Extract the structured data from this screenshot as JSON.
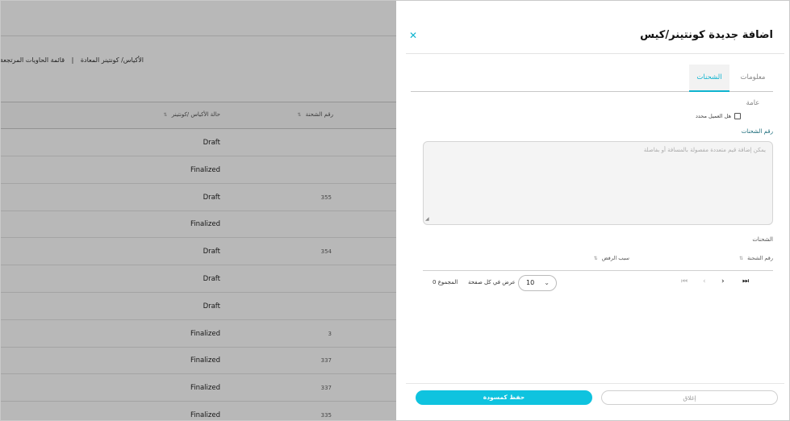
{
  "background": {
    "breadcrumb": {
      "item1": "الأكياس/ كونتينر المعادة",
      "separator": "|",
      "item2": "قائمة الحاويات المرتجعة"
    },
    "columns": {
      "status": "حالة الأكياس /كونتينر",
      "shipment_no": "رقم الشحنة"
    },
    "rows": [
      {
        "status": "Draft",
        "num": ""
      },
      {
        "status": "Finalized",
        "num": ""
      },
      {
        "status": "Draft",
        "num": "355"
      },
      {
        "status": "Finalized",
        "num": ""
      },
      {
        "status": "Draft",
        "num": "354"
      },
      {
        "status": "Draft",
        "num": ""
      },
      {
        "status": "Draft",
        "num": ""
      },
      {
        "status": "Finalized",
        "num": "3"
      },
      {
        "status": "Finalized",
        "num": "337"
      },
      {
        "status": "Finalized",
        "num": "337"
      },
      {
        "status": "Finalized",
        "num": "335"
      }
    ]
  },
  "drawer": {
    "title": "اضافة جديدة كونتينر/كيس",
    "close_icon": "✕",
    "tabs": {
      "general": "معلومات عامة",
      "shipments": "الشحنات"
    },
    "checkbox_label": "هل العميل محدد",
    "shipment_number_label": "رقم الشحنات",
    "textarea_placeholder": "يمكن إضافة قيم متعددة مفصولة بالمسافة أو بفاصلة",
    "shipments_title": "الشحنات",
    "table_columns": {
      "shipment_no": "رقم الشحنة",
      "reject_reason": "سبب الرفض"
    },
    "pagination": {
      "per_page_value": "10",
      "per_page_label": "عرض في كل صفحة",
      "total": "المجموع 0",
      "first_icon": "⏮",
      "prev_icon": "‹",
      "next_icon": "›",
      "last_icon": "⏭"
    },
    "buttons": {
      "close": "إغلاق",
      "save_draft": "حفظ كمسودة"
    }
  }
}
